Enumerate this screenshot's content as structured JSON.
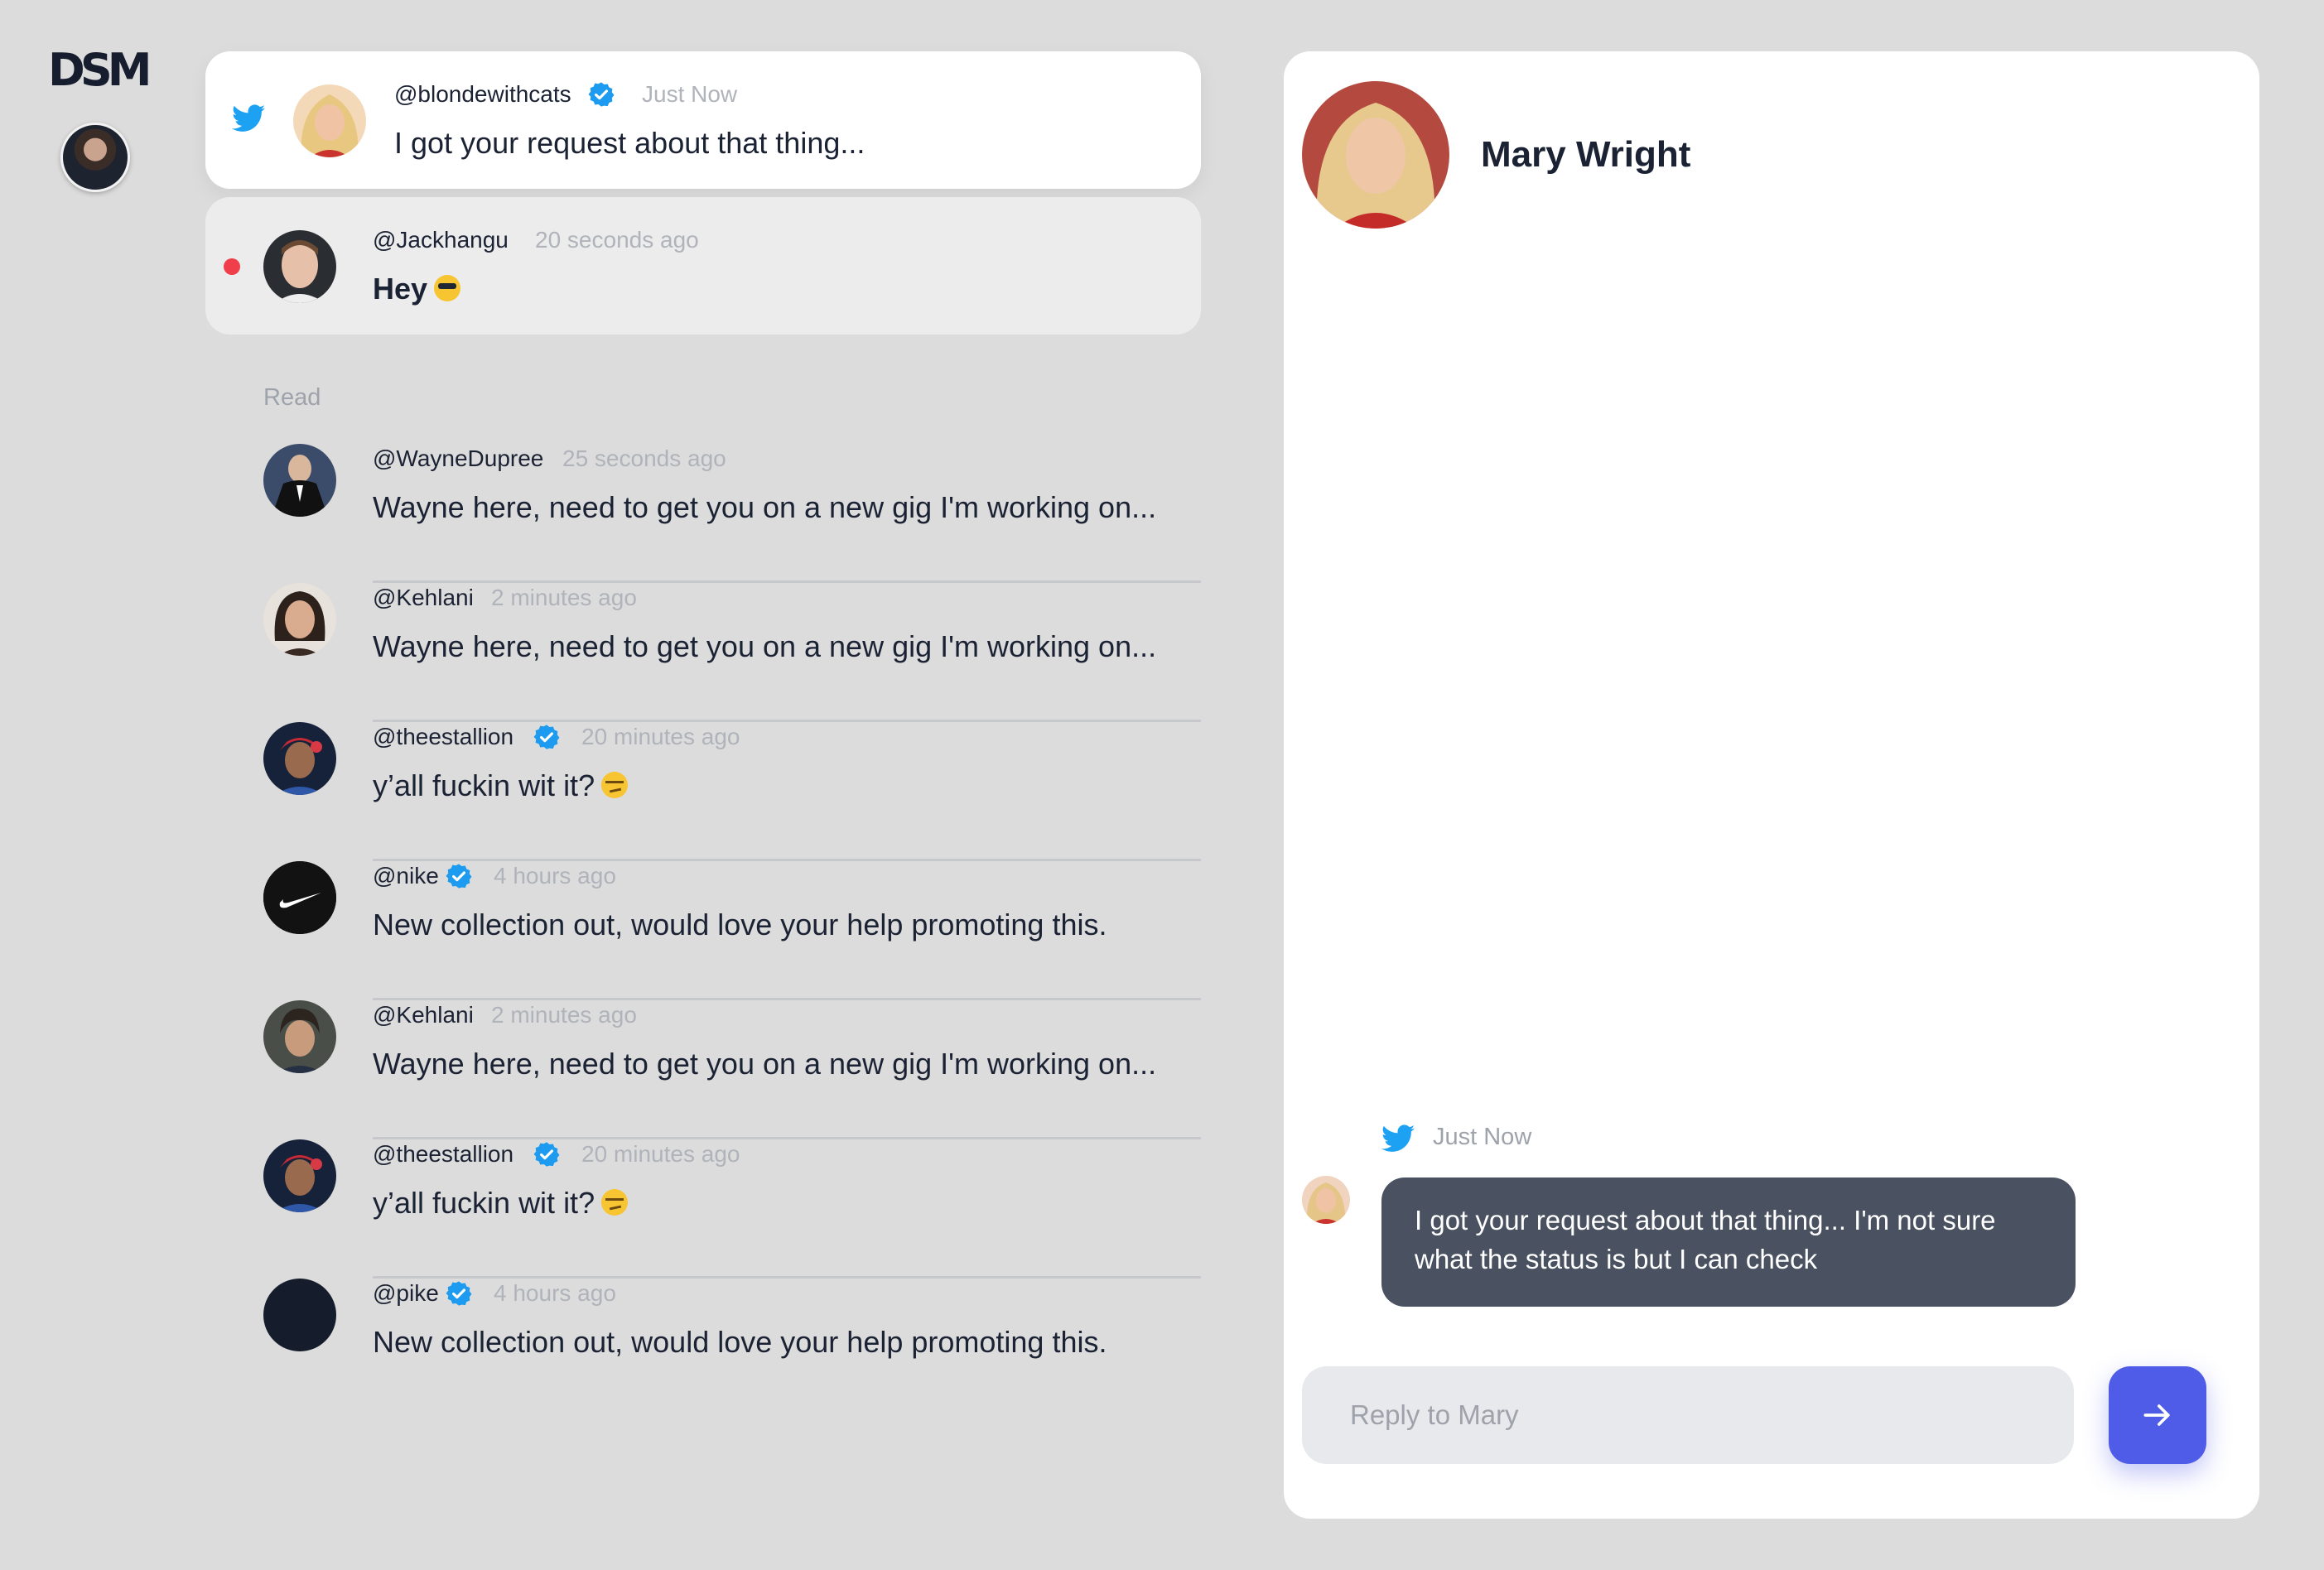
{
  "app": {
    "logo": "DSM"
  },
  "inbox": {
    "active": {
      "handle": "@blondewithcats",
      "time": "Just Now",
      "message": "I got your request about that thing...",
      "verified": true,
      "source_icon": "twitter-icon"
    },
    "unread": {
      "handle": "@Jackhangu",
      "time": "20 seconds ago",
      "message": "Hey",
      "emoji": "sunglasses-emoji"
    },
    "read_label": "Read",
    "read_items": [
      {
        "handle": "@WayneDupree",
        "time": "25 seconds ago",
        "message": "Wayne here, need to get you on a new gig I'm working on...",
        "verified": false
      },
      {
        "handle": "@Kehlani",
        "time": "2 minutes ago",
        "message": "Wayne here, need to get you on a new gig I'm working on...",
        "verified": false
      },
      {
        "handle": "@theestallion",
        "time": "20 minutes ago",
        "message": "y’all fuckin wit it?",
        "verified": true,
        "emoji": "smirk-emoji"
      },
      {
        "handle": "@nike",
        "time": "4 hours ago",
        "message": "New collection out, would love your help promoting this.",
        "verified": true
      },
      {
        "handle": "@Kehlani",
        "time": "2 minutes ago",
        "message": "Wayne here, need to get you on a new gig I'm working on...",
        "verified": false
      },
      {
        "handle": "@theestallion",
        "time": "20 minutes ago",
        "message": "y’all fuckin wit it?",
        "verified": true,
        "emoji": "smirk-emoji"
      },
      {
        "handle": "@pike",
        "time": "4 hours ago",
        "message": "New collection out, would love your help promoting this.",
        "verified": true
      }
    ]
  },
  "chat": {
    "name": "Mary Wright",
    "message_time": "Just Now",
    "message_text": "I got your request about that thing... I'm not sure what the status is but I can check",
    "reply_placeholder": "Reply to Mary",
    "send_icon": "arrow-right-icon"
  },
  "colors": {
    "accent": "#4f5ce8",
    "twitter": "#1da1f2",
    "verified": "#1d9bf0",
    "unread_dot": "#f03e4a",
    "bubble": "#4a5261"
  }
}
